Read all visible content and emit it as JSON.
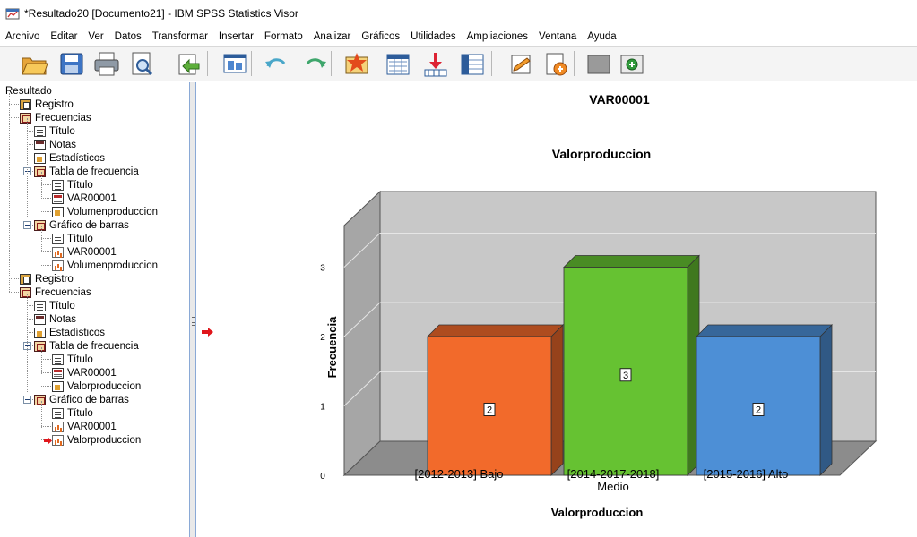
{
  "window": {
    "title": "*Resultado20 [Documento21] - IBM SPSS Statistics Visor"
  },
  "menu": [
    "Archivo",
    "Editar",
    "Ver",
    "Datos",
    "Transformar",
    "Insertar",
    "Formato",
    "Analizar",
    "Gráficos",
    "Utilidades",
    "Ampliaciones",
    "Ventana",
    "Ayuda"
  ],
  "toolbar": {
    "buttons": [
      "open-icon",
      "save-icon",
      "print-icon",
      "print-preview-icon",
      "export-icon",
      "recall-dialog-icon",
      "undo-icon",
      "redo-icon",
      "goto-case-icon",
      "goto-variable-icon",
      "insert-heading-icon",
      "insert-table-icon",
      "insert-text-icon",
      "insert-title-icon",
      "show-hide-icon",
      "designate-window-icon"
    ]
  },
  "tree": [
    {
      "label": "Resultado",
      "icon": "none",
      "level": 0
    },
    {
      "label": "Registro",
      "icon": "log",
      "level": 1
    },
    {
      "label": "Frecuencias",
      "icon": "freq",
      "level": 1,
      "expandable": true
    },
    {
      "label": "Título",
      "icon": "doc",
      "level": 2
    },
    {
      "label": "Notas",
      "icon": "notes",
      "level": 2
    },
    {
      "label": "Estadísticos",
      "icon": "stats",
      "level": 2
    },
    {
      "label": "Tabla de frecuencia",
      "icon": "freq",
      "level": 2,
      "expandable": true
    },
    {
      "label": "Título",
      "icon": "doc",
      "level": 3
    },
    {
      "label": "VAR00001",
      "icon": "table",
      "level": 3
    },
    {
      "label": "Volumenproduccion",
      "icon": "stats",
      "level": 3
    },
    {
      "label": "Gráfico de barras",
      "icon": "freq",
      "level": 2,
      "expandable": true
    },
    {
      "label": "Título",
      "icon": "doc",
      "level": 3
    },
    {
      "label": "VAR00001",
      "icon": "chart",
      "level": 3
    },
    {
      "label": "Volumenproduccion",
      "icon": "chart",
      "level": 3
    },
    {
      "label": "Registro",
      "icon": "log",
      "level": 1
    },
    {
      "label": "Frecuencias",
      "icon": "freq",
      "level": 1,
      "expandable": true
    },
    {
      "label": "Título",
      "icon": "doc",
      "level": 2
    },
    {
      "label": "Notas",
      "icon": "notes",
      "level": 2
    },
    {
      "label": "Estadísticos",
      "icon": "stats",
      "level": 2
    },
    {
      "label": "Tabla de frecuencia",
      "icon": "freq",
      "level": 2,
      "expandable": true
    },
    {
      "label": "Título",
      "icon": "doc",
      "level": 3
    },
    {
      "label": "VAR00001",
      "icon": "table",
      "level": 3
    },
    {
      "label": "Valorproduccion",
      "icon": "stats",
      "level": 3
    },
    {
      "label": "Gráfico de barras",
      "icon": "freq",
      "level": 2,
      "expandable": true
    },
    {
      "label": "Título",
      "icon": "doc",
      "level": 3
    },
    {
      "label": "VAR00001",
      "icon": "chart",
      "level": 3
    },
    {
      "label": "Valorproduccion",
      "icon": "chart",
      "level": 3,
      "selected": true
    }
  ],
  "output": {
    "section_title": "VAR00001"
  },
  "chart_data": {
    "type": "bar",
    "title": "Valorproduccion",
    "xlabel": "Valorproduccion",
    "ylabel": "Frecuencia",
    "categories": [
      "[2012-2013] Bajo",
      "[2014-2017-2018] Medio",
      "[2015-2016] Alto"
    ],
    "category_lines": [
      [
        "[2012-2013] Bajo"
      ],
      [
        "[2014-2017-2018]",
        "Medio"
      ],
      [
        "[2015-2016] Alto"
      ]
    ],
    "values": [
      2,
      3,
      2
    ],
    "bar_labels": [
      "2",
      "3",
      "2"
    ],
    "colors": [
      "#f26a2b",
      "#66c232",
      "#4d8fd6"
    ],
    "ylim": [
      0,
      3.6
    ],
    "yticks": [
      0,
      1,
      2,
      3
    ],
    "grid": true,
    "style": "3d"
  }
}
